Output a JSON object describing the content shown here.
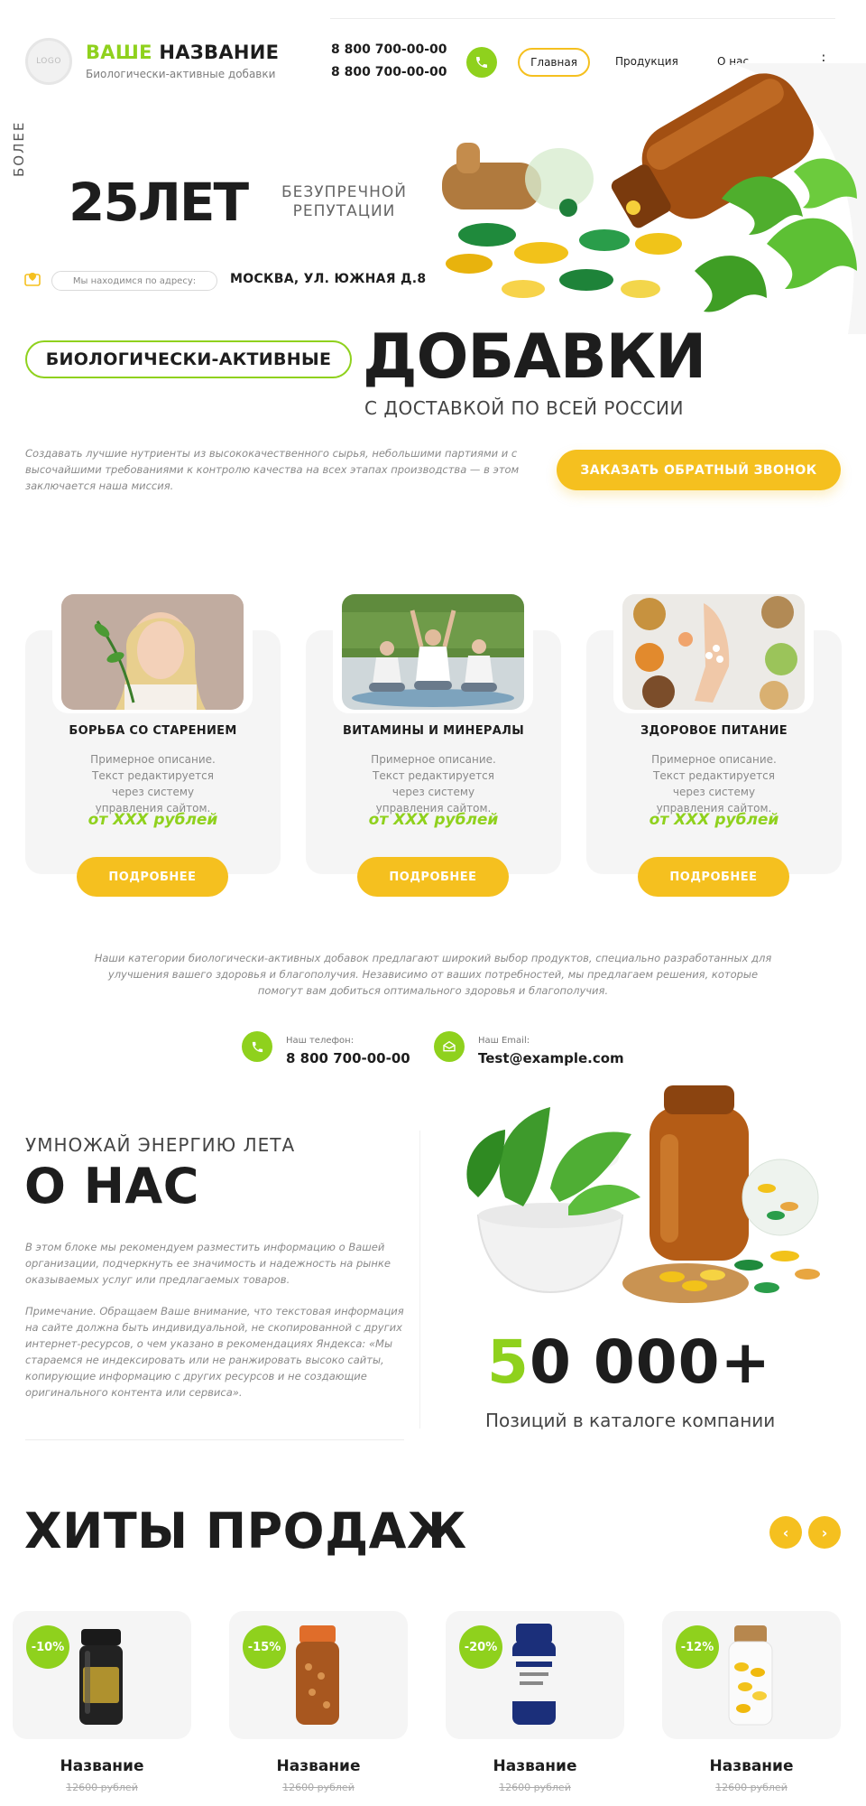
{
  "header": {
    "logo_text": "LOGO",
    "brand_accent": "ВАШЕ",
    "brand_rest": " НАЗВАНИЕ",
    "brand_sub": "Биологически-активные добавки",
    "phone_1": "8 800 700-00-00",
    "phone_2": "8 800 700-00-00",
    "nav": [
      "Главная",
      "Продукция",
      "О нас"
    ],
    "more_icon": "more-vertical-icon"
  },
  "hero": {
    "more_label": "БОЛЕЕ",
    "years": "25ЛЕТ",
    "years_caption_1": "БЕЗУПРЕЧНОЙ",
    "years_caption_2": "РЕПУТАЦИИ",
    "address_pill": "Мы находимся по адресу:",
    "address": "МОСКВА, УЛ. ЮЖНАЯ Д.8",
    "bio_label": "БИОЛОГИЧЕСКИ-АКТИВНЫЕ",
    "headline": "ДОБАВКИ",
    "delivery": "С ДОСТАВКОЙ ПО ВСЕЙ РОССИИ",
    "mission": "Создавать лучшие нутриенты из высококачественного сырья, небольшими партиями и с высочайшими требованиями к контролю качества на всех этапах производства — в этом заключается наша миссия.",
    "cta": "ЗАКАЗАТЬ ОБРАТНЫЙ ЗВОНОК"
  },
  "categories": [
    {
      "title": "БОРЬБА СО СТАРЕНИЕМ",
      "desc": "Примерное описание. Текст редактируется через систему управления сайтом.",
      "price": "от XXX рублей",
      "button": "ПОДРОБНЕЕ"
    },
    {
      "title": "ВИТАМИНЫ И МИНЕРАЛЫ",
      "desc": "Примерное описание. Текст редактируется через систему управления сайтом.",
      "price": "от XXX рублей",
      "button": "ПОДРОБНЕЕ"
    },
    {
      "title": "ЗДОРОВОЕ ПИТАНИЕ",
      "desc": "Примерное описание. Текст редактируется через систему управления сайтом.",
      "price": "от XXX рублей",
      "button": "ПОДРОБНЕЕ"
    }
  ],
  "categories_text": "Наши категории биологически-активных добавок предлагают широкий выбор продуктов, специально разработанных для улучшения вашего здоровья и благополучия. Независимо от ваших потребностей, мы предлагаем решения, которые помогут вам добиться оптимального здоровья и благополучия.",
  "contacts": {
    "phone_label": "Наш телефон:",
    "phone_value": "8 800 700-00-00",
    "email_label": "Наш Email:",
    "email_value": "Test@example.com"
  },
  "about": {
    "kicker": "УМНОЖАЙ ЭНЕРГИЮ ЛЕТА",
    "title": "О НАС",
    "p1": "В этом блоке мы рекомендуем разместить информацию о Вашей организации, подчеркнуть ее значимость и надежность на рынке оказываемых услуг или предлагаемых товаров.",
    "p2": "Примечание. Обращаем Ваше внимание, что текстовая информация на сайте должна быть индивидуальной, не скопированной с других интернет-ресурсов, о чем указано в рекомендациях Яндекса: «Мы стараемся не индексировать или не ранжировать высоко сайты, копирующие информацию с других ресурсов и не создающие оригинального контента или сервиса».",
    "big_number_accent": "5",
    "big_number_rest": "0 000+",
    "big_caption": "Позиций в каталоге компании"
  },
  "hits": {
    "title": "ХИТЫ ПРОДАЖ",
    "prev": "‹",
    "next": "›",
    "products": [
      {
        "badge": "-10%",
        "name": "Название",
        "old_price": "12600 рублей"
      },
      {
        "badge": "-15%",
        "name": "Название",
        "old_price": "12600 рублей"
      },
      {
        "badge": "-20%",
        "name": "Название",
        "old_price": "12600 рублей"
      },
      {
        "badge": "-12%",
        "name": "Название",
        "old_price": "12600 рублей"
      }
    ]
  },
  "colors": {
    "accent_green": "#8fd11d",
    "accent_yellow": "#f5c01f",
    "text": "#1d1d1d"
  }
}
